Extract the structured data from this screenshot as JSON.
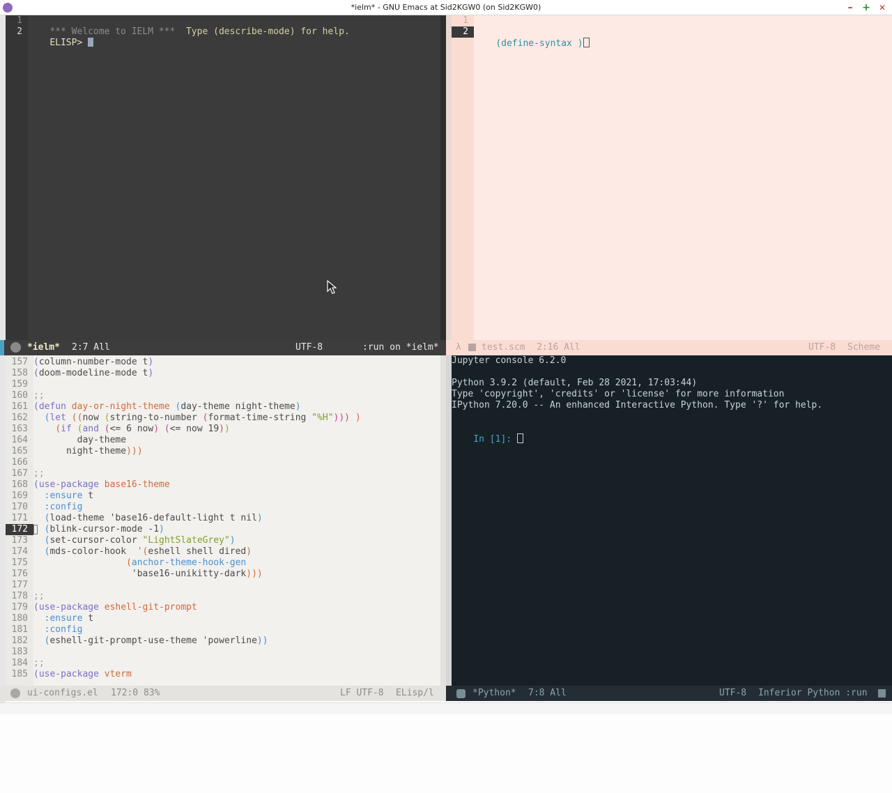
{
  "titlebar": {
    "title": "*ielm* - GNU Emacs at Sid2KGW0 (on Sid2KGW0)",
    "minimize": "–",
    "maximize": "+",
    "close": "✕"
  },
  "ielm": {
    "line_numbers": [
      "1",
      "2"
    ],
    "line1_comment": "*** Welcome to IELM ***",
    "line1_text": "  Type (describe-mode) for help.",
    "line2_prompt": "ELISP> ",
    "modeline": {
      "buffer": "*ielm*",
      "position": "2:7 All",
      "encoding": "UTF-8",
      "process": ":run on *ielm*"
    }
  },
  "scheme": {
    "line_numbers": [
      "1",
      "2"
    ],
    "line2_text": "(define-syntax )",
    "modeline": {
      "lambda": "λ",
      "buffer": "test.scm",
      "position": "2:16 All",
      "encoding": "UTF-8",
      "mode": "Scheme"
    }
  },
  "elisp": {
    "line_numbers": [
      "157",
      "158",
      "159",
      "160",
      "161",
      "162",
      "163",
      "164",
      "165",
      "166",
      "167",
      "168",
      "169",
      "170",
      "171",
      "172",
      "173",
      "174",
      "175",
      "176",
      "177",
      "178",
      "179",
      "180",
      "181",
      "182",
      "183",
      "184",
      "185"
    ],
    "current_line": "172",
    "modeline": {
      "buffer": "ui-configs.el",
      "position": "172:0 83%",
      "eol": "LF UTF-8",
      "mode": "ELisp/l"
    }
  },
  "python": {
    "header": "Jupyter console 6.2.0",
    "version_line": "Python 3.9.2 (default, Feb 28 2021, 17:03:44)",
    "info_line": "Type 'copyright', 'credits' or 'license' for more information",
    "ipython_line": "IPython 7.20.0 -- An enhanced Interactive Python. Type '?' for help.",
    "prompt": "In [1]: ",
    "modeline": {
      "buffer": "*Python*",
      "position": "7:8 All",
      "encoding": "UTF-8",
      "mode": "Inferior Python :run"
    }
  },
  "code_lines": [
    [
      [
        "(",
        "p"
      ],
      [
        "column-number-mode t",
        "d"
      ],
      [
        ")",
        "p"
      ]
    ],
    [
      [
        "(",
        "p"
      ],
      [
        "doom-modeline-mode t",
        "d"
      ],
      [
        ")",
        "p"
      ]
    ],
    [],
    [
      [
        ";;",
        "c"
      ]
    ],
    [
      [
        "(",
        "p"
      ],
      [
        "defun",
        "k"
      ],
      [
        " ",
        "d"
      ],
      [
        "day-or-night-theme",
        "f"
      ],
      [
        " ",
        "d"
      ],
      [
        "(",
        "p2"
      ],
      [
        "day-theme night-theme",
        "d"
      ],
      [
        ")",
        "p2"
      ]
    ],
    [
      [
        "  ",
        "d"
      ],
      [
        "(",
        "p2"
      ],
      [
        "let",
        "k"
      ],
      [
        " ",
        "d"
      ],
      [
        "((",
        "p3"
      ],
      [
        "now ",
        "d"
      ],
      [
        "(",
        "p4"
      ],
      [
        "string-to-number ",
        "d"
      ],
      [
        "(",
        "p5"
      ],
      [
        "format-time-string ",
        "d"
      ],
      [
        "\"%H\"",
        "s"
      ],
      [
        ")))",
        "p5"
      ],
      [
        " )",
        "p3"
      ]
    ],
    [
      [
        "    ",
        "d"
      ],
      [
        "(",
        "p3"
      ],
      [
        "if",
        "k"
      ],
      [
        " ",
        "d"
      ],
      [
        "(",
        "p4"
      ],
      [
        "and",
        "k"
      ],
      [
        " ",
        "d"
      ],
      [
        "(",
        "p5"
      ],
      [
        "<= 6 now",
        "d"
      ],
      [
        ")",
        "p5"
      ],
      [
        " ",
        "d"
      ],
      [
        "(",
        "p5"
      ],
      [
        "<= now 19",
        "d"
      ],
      [
        ")",
        "p5"
      ],
      [
        ")",
        "p4"
      ]
    ],
    [
      [
        "        day-theme",
        "d"
      ]
    ],
    [
      [
        "      night-theme",
        "d"
      ],
      [
        ")))",
        "p3"
      ]
    ],
    [],
    [
      [
        ";;",
        "c"
      ]
    ],
    [
      [
        "(",
        "p"
      ],
      [
        "use-package",
        "k"
      ],
      [
        " ",
        "d"
      ],
      [
        "base16-theme",
        "f"
      ]
    ],
    [
      [
        "  ",
        "d"
      ],
      [
        ":ensure",
        "b"
      ],
      [
        " t",
        "d"
      ]
    ],
    [
      [
        "  ",
        "d"
      ],
      [
        ":config",
        "b"
      ]
    ],
    [
      [
        "  ",
        "d"
      ],
      [
        "(",
        "p2"
      ],
      [
        "load-theme ",
        "d"
      ],
      [
        "'base16-default-light t nil",
        "d"
      ],
      [
        ")",
        "p2"
      ]
    ],
    [
      [
        "  ",
        "d"
      ],
      [
        "(",
        "p2"
      ],
      [
        "blink-cursor-mode -1",
        "d"
      ],
      [
        ")",
        "p2"
      ]
    ],
    [
      [
        "  ",
        "d"
      ],
      [
        "(",
        "p2"
      ],
      [
        "set-cursor-color ",
        "d"
      ],
      [
        "\"LightSlateGrey\"",
        "s"
      ],
      [
        ")",
        "p2"
      ]
    ],
    [
      [
        "  ",
        "d"
      ],
      [
        "(",
        "p2"
      ],
      [
        "mds-color-hook  ",
        "d"
      ],
      [
        "'(",
        "p3"
      ],
      [
        "eshell shell dired",
        "d"
      ],
      [
        ")",
        "p3"
      ]
    ],
    [
      [
        "                 ",
        "d"
      ],
      [
        "(",
        "p3"
      ],
      [
        "anchor-theme-hook-gen",
        "b"
      ]
    ],
    [
      [
        "                  'base16-unikitty-dark",
        "d"
      ],
      [
        ")))",
        "p3"
      ]
    ],
    [],
    [
      [
        ";;",
        "c"
      ]
    ],
    [
      [
        "(",
        "p"
      ],
      [
        "use-package",
        "k"
      ],
      [
        " ",
        "d"
      ],
      [
        "eshell-git-prompt",
        "f"
      ]
    ],
    [
      [
        "  ",
        "d"
      ],
      [
        ":ensure",
        "b"
      ],
      [
        " t",
        "d"
      ]
    ],
    [
      [
        "  ",
        "d"
      ],
      [
        ":config",
        "b"
      ]
    ],
    [
      [
        "  ",
        "d"
      ],
      [
        "(",
        "p2"
      ],
      [
        "eshell-git-prompt-use-theme ",
        "d"
      ],
      [
        "'powerline",
        "d"
      ],
      [
        "))",
        "p2"
      ]
    ],
    [],
    [
      [
        ";;",
        "c"
      ]
    ],
    [
      [
        "(",
        "p"
      ],
      [
        "use-package",
        "k"
      ],
      [
        " ",
        "d"
      ],
      [
        "vterm",
        "f"
      ]
    ]
  ],
  "colors": {
    "ielm_bg": "#3b3b3b",
    "scheme_bg": "#fdeae4",
    "elisp_bg": "#f2f1ee",
    "python_bg": "#172025",
    "accent": "#4aa3c4"
  }
}
